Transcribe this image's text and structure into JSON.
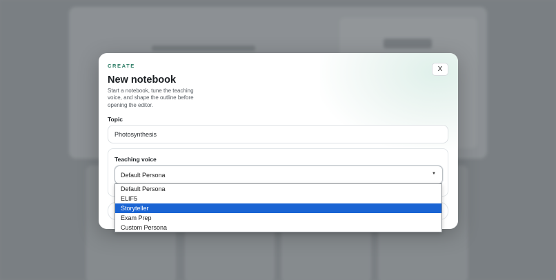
{
  "modal": {
    "eyebrow": "CREATE",
    "title": "New notebook",
    "subtitle": "Start a notebook, tune the teaching voice, and shape the outline before opening the editor.",
    "close_label": "X",
    "accent_color": "#2a7b63"
  },
  "topic": {
    "label": "Topic",
    "value": "Photosynthesis"
  },
  "teaching_voice": {
    "label": "Teaching voice",
    "selected": "Default Persona",
    "chevron_icon": "chevron-down-icon",
    "options": [
      {
        "label": "Default Persona",
        "highlighted": false
      },
      {
        "label": "ELIF5",
        "highlighted": false
      },
      {
        "label": "Storyteller",
        "highlighted": true
      },
      {
        "label": "Exam Prep",
        "highlighted": false
      },
      {
        "label": "Custom Persona",
        "highlighted": false
      }
    ],
    "highlight_color": "#1a64d3"
  }
}
